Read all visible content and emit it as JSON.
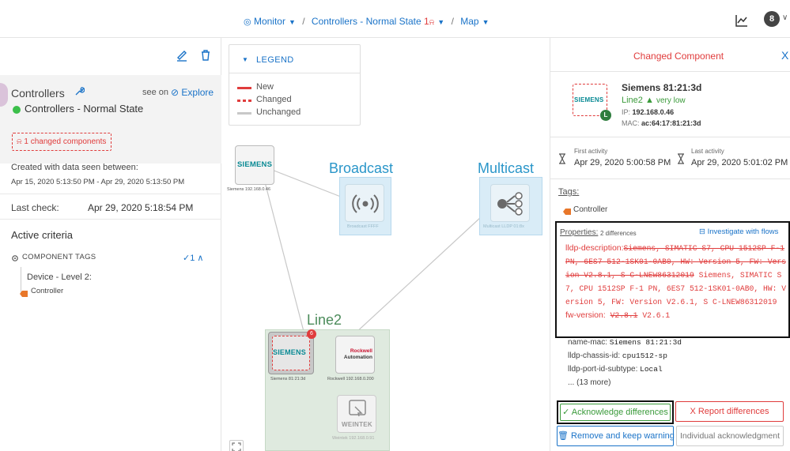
{
  "topbar": {
    "monitor_label": "Monitor",
    "separator": "/",
    "controllers_label": "Controllers - Normal State",
    "controllers_count": "1",
    "map_label": "Map",
    "avatar_letter": "8",
    "chevron": "∨"
  },
  "left": {
    "controllers_title": "Controllers",
    "see_on": "see on",
    "explore": "Explore",
    "state_label": "Controllers - Normal State",
    "changed_badge": "1 changed components",
    "created_text": "Created with data seen between:",
    "date_range": "Apr 15, 2020 5:13:50 PM - Apr 29, 2020 5:13:50 PM",
    "last_check_label": "Last check:",
    "last_check_value": "Apr 29, 2020 5:18:54 PM",
    "active_criteria": "Active criteria",
    "component_tags": "COMPONENT TAGS",
    "component_tags_count": "✓1 ∧",
    "device_level": "Device - Level 2:",
    "controller_tag": "Controller"
  },
  "legend": {
    "title": "LEGEND",
    "items": [
      {
        "label": "New",
        "color": "#e03c3c",
        "style": "solid"
      },
      {
        "label": "Changed",
        "color": "#e03c3c",
        "style": "dashed"
      },
      {
        "label": "Unchanged",
        "color": "#c8c8c8",
        "style": "solid"
      }
    ]
  },
  "map": {
    "broadcast_label": "Broadcast",
    "multicast_label": "Multicast",
    "line2_label": "Line2",
    "siemens_top_logo": "SIEMENS",
    "siemens_top_caption": "Siemens 192.168.0.46",
    "broadcast_caption": "Broadcast FFFF",
    "multicast_caption": "Multicast LLDP 01:8x",
    "siemens_changed_logo": "SIEMENS",
    "siemens_changed_caption": "Siemens 81:21:3d",
    "siemens_changed_badge": "6",
    "rockwell_logo_1": "Rockwell",
    "rockwell_logo_2": "Automation",
    "rockwell_caption": "Rockwell 192.168.0.200",
    "weintek_logo": "WEINTEK",
    "weintek_caption": "Weintek 192.168.0.91"
  },
  "right": {
    "title": "Changed Component",
    "close": "X",
    "thumb_logo": "SIEMENS",
    "thumb_badge": "L",
    "name": "Siemens 81:21:3d",
    "line2": "Line2",
    "level": "very low",
    "ip_label": "IP:",
    "ip": "192.168.0.46",
    "mac_label": "MAC:",
    "mac": "ac:64:17:81:21:3d",
    "first_activity_label": "First activity",
    "first_activity": "Apr 29, 2020 5:00:58 PM",
    "last_activity_label": "Last activity",
    "last_activity": "Apr 29, 2020 5:01:02 PM",
    "tags_label": "Tags:",
    "tag": "Controller",
    "properties_label": "Properties:",
    "properties_diff": "2 differences",
    "investigate": "Investigate with flows",
    "lldp_desc_key": "lldp-description:",
    "lldp_desc_old": "Siemens, SIMATIC S7, CPU 1512SP F-1 PN, 6ES7 512-1SK01-0AB0, HW: Version 5, FW: Version V2.8.1, S C-LNEW86312019",
    "lldp_desc_new": "Siemens, SIMATIC S7, CPU 1512SP F-1 PN, 6ES7 512-1SK01-0AB0, HW: Version 5, FW: Version V2.6.1, S C-LNEW86312019",
    "fw_key": "fw-version:",
    "fw_old": "V2.8.1",
    "fw_new": "V2.6.1",
    "name_mac_key": "name-mac:",
    "name_mac_val": "Siemens 81:21:3d",
    "chassis_key": "lldp-chassis-id:",
    "chassis_val": "cpu1512-sp",
    "port_key": "lldp-port-id-subtype:",
    "port_val": "Local",
    "more": "... (13 more)",
    "ack_button": "✓  Acknowledge differences",
    "report_button": "X  Report differences",
    "remove_button": "Remove and keep warning",
    "individual_button": "Individual acknowledgment"
  },
  "colors": {
    "accent": "#1a73c8",
    "changed": "#e03c3c",
    "ok": "#3bbf4a",
    "broadcast": "#2a96c9",
    "line2": "#4b8b5a"
  }
}
